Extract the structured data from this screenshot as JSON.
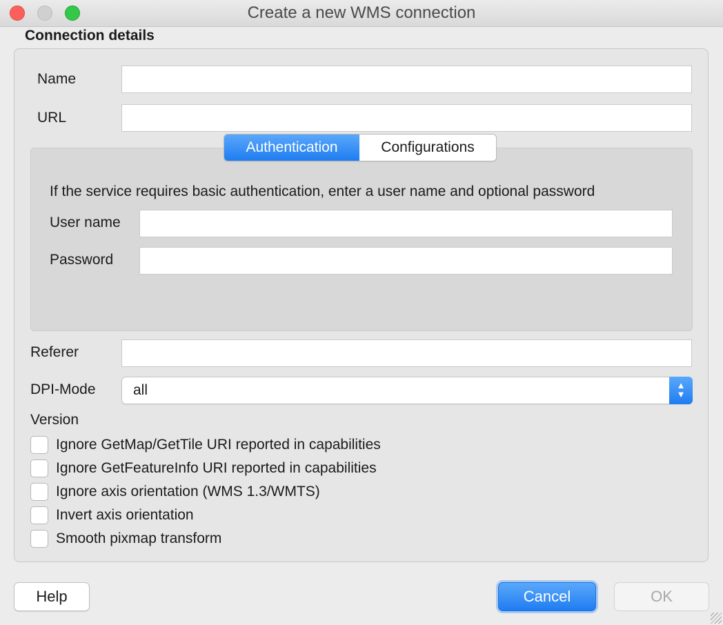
{
  "window": {
    "title": "Create a new WMS connection"
  },
  "connection_details": {
    "group_title": "Connection details",
    "name_label": "Name",
    "name_value": "",
    "url_label": "URL",
    "url_value": ""
  },
  "tabs": [
    {
      "label": "Authentication",
      "active": true
    },
    {
      "label": "Configurations",
      "active": false
    }
  ],
  "authentication": {
    "info_text": "If the service requires basic authentication, enter a user name and optional password",
    "username_label": "User name",
    "username_value": "",
    "password_label": "Password",
    "password_value": ""
  },
  "referer": {
    "label": "Referer",
    "value": ""
  },
  "dpi_mode": {
    "label": "DPI-Mode",
    "selected": "all",
    "arrow_icon": "updown-chevron-icon"
  },
  "version": {
    "label": "Version"
  },
  "checkboxes": [
    {
      "label": "Ignore GetMap/GetTile URI reported in capabilities",
      "checked": false
    },
    {
      "label": "Ignore GetFeatureInfo URI reported in capabilities",
      "checked": false
    },
    {
      "label": "Ignore axis orientation (WMS 1.3/WMTS)",
      "checked": false
    },
    {
      "label": "Invert axis orientation",
      "checked": false
    },
    {
      "label": "Smooth pixmap transform",
      "checked": false
    }
  ],
  "buttons": {
    "help": "Help",
    "cancel": "Cancel",
    "ok": "OK"
  },
  "colors": {
    "accent": "#1f7cf0",
    "close": "#fc605b",
    "maximize": "#34c748",
    "minimize": "#d0d0d0"
  }
}
